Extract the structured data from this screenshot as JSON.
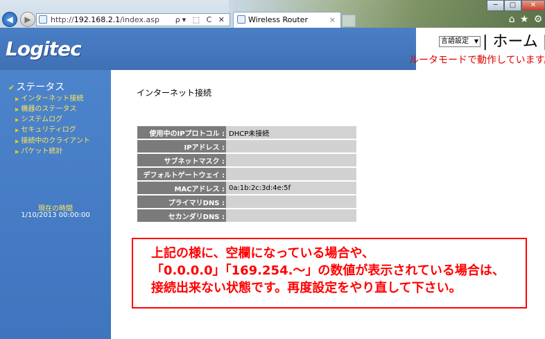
{
  "browser": {
    "url_prefix": "http://",
    "url_host": "192.168.2.1",
    "url_path": "/index.asp",
    "url_tools": "ρ▾ ⬚ C ✕",
    "tab_title": "Wireless Router",
    "tab_close": "×",
    "win_min": "─",
    "win_max": "□",
    "win_close": "✕",
    "tool_home": "⌂",
    "tool_star": "★",
    "tool_gear": "⚙"
  },
  "header": {
    "logo": "Logitec",
    "language_select": "言語設定",
    "home_link": "| ホーム |",
    "mode_text": "ルータモードで動作しています。"
  },
  "sidebar": {
    "section": "ステータス",
    "items": [
      {
        "label": "インターネット接続"
      },
      {
        "label": "機器のステータス"
      },
      {
        "label": "システムログ"
      },
      {
        "label": "セキュリティログ"
      },
      {
        "label": "接続中のクライアント"
      },
      {
        "label": "パケット統計"
      }
    ],
    "clock_label": "現在の時間",
    "clock_value": "1/10/2013 00:00:00"
  },
  "main": {
    "title": "インターネット接続",
    "rows": [
      {
        "label": "使用中のIPプロトコル :",
        "value": "DHCP未接続"
      },
      {
        "label": "IPアドレス :",
        "value": ""
      },
      {
        "label": "サブネットマスク :",
        "value": ""
      },
      {
        "label": "デフォルトゲートウェイ :",
        "value": ""
      },
      {
        "label": "MACアドレス :",
        "value": "0a:1b:2c:3d:4e:5f"
      },
      {
        "label": "プライマリDNS :",
        "value": ""
      },
      {
        "label": "セカンダリDNS :",
        "value": ""
      }
    ],
    "note_lines": [
      "上記の様に、空欄になっている場合や、",
      "「0.0.0.0」「169.254.～」の数値が表示されている場合は、",
      "接続出来ない状態です。再度設定をやり直して下さい。"
    ]
  },
  "colors": {
    "header_blue": "#4a7fc5",
    "sidebar_blue": "#4c84cc",
    "sidebar_link": "#ffe45c",
    "alert_red": "#ff0000",
    "label_cell": "#7b7b7b",
    "value_cell": "#d2d2d2"
  }
}
